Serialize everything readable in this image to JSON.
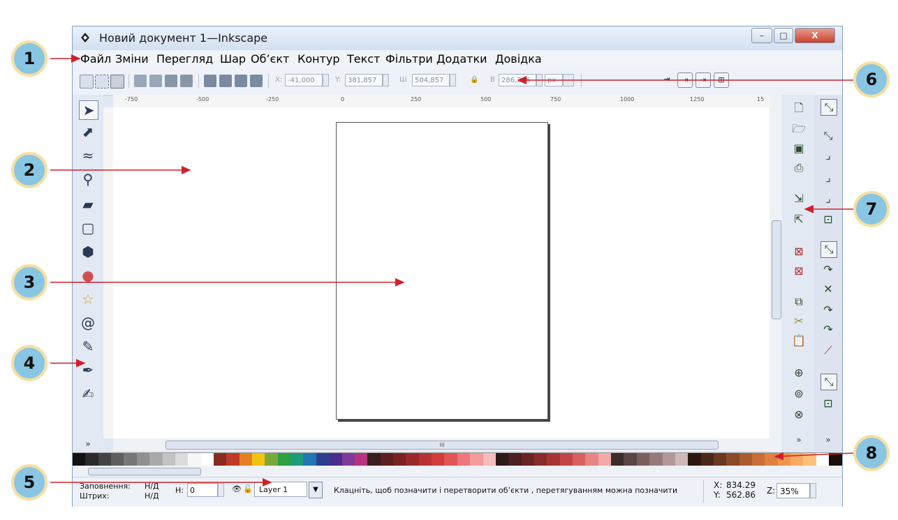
{
  "window": {
    "title": "Новий документ 1—Inkscape",
    "controls": {
      "minimize": "–",
      "maximize": "□",
      "close": "X"
    }
  },
  "menu": [
    "Файл",
    "Зміни",
    "Перегляд",
    "Шар",
    "Об’єкт",
    "Контур",
    "Текст",
    "Фільтри",
    "Додатки",
    "Довідка"
  ],
  "toolbar": {
    "x_label": "X:",
    "x_value": "-41,000",
    "y_label": "Y:",
    "y_value": "381,857",
    "w_label": "Ш",
    "w_value": "504,857",
    "h_label": "В",
    "h_value": "286,266",
    "units": "px"
  },
  "ruler": {
    "h_ticks": [
      "-750",
      "-500",
      "-250",
      "0",
      "250",
      "500",
      "750",
      "1000",
      "1250",
      "15"
    ]
  },
  "scroll": {
    "hscroll_grip": "III",
    "vscroll_grip": "III",
    "more": "»"
  },
  "status": {
    "fill_label": "Заповнення:",
    "fill_value": "Н/Д",
    "stroke_label": "Штрих:",
    "stroke_value": "Н/Д",
    "opacity_label": "Н:",
    "opacity_value": "0",
    "layer": "Layer 1",
    "message": "Клацніть, щоб позначити  і перетворити об’єкти , перетягуванням можна позначити",
    "x_label": "X:",
    "x_value": "834.29",
    "y_label": "Y:",
    "y_value": "562.86",
    "zoom_label": "Z:",
    "zoom_value": "35%"
  },
  "callouts": [
    "1",
    "2",
    "3",
    "4",
    "5",
    "6",
    "7",
    "8"
  ],
  "palette": [
    "#111111",
    "#2a2a2a",
    "#444444",
    "#5e5e5e",
    "#777777",
    "#909090",
    "#a9a9a9",
    "#c3c3c3",
    "#dcdcdc",
    "#f6f6f6",
    "#ffffff",
    "#8a2a20",
    "#c0392b",
    "#e67e22",
    "#f1c40f",
    "#7aa83a",
    "#2ea043",
    "#1b9e77",
    "#1f77b4",
    "#2c3e90",
    "#4b2c8c",
    "#7d3c98",
    "#b83280",
    "#3a1e1e",
    "#5c1f1f",
    "#7a2222",
    "#9a2a2a",
    "#b83232",
    "#d23c3c",
    "#e25555",
    "#ee7777",
    "#f49a9a",
    "#f8bcbc",
    "#2d1a1a",
    "#4a2020",
    "#6b2424",
    "#8a2b2b",
    "#a83535",
    "#c44545",
    "#d96060",
    "#e88383",
    "#f2a9a9",
    "#3b2b2b",
    "#5a4444",
    "#7a5e5e",
    "#967a7a",
    "#b29898",
    "#cdb9b9",
    "#2a1810",
    "#4a2818",
    "#6a3820",
    "#8a4a28",
    "#aa5c30",
    "#c86e38",
    "#e08040",
    "#f0944c",
    "#f8aa60",
    "#fcc07a",
    "#ffffff",
    "#1a0e0a"
  ],
  "colors": {
    "accent": "#88c6e4",
    "callout_border": "#f6dfa2",
    "arrow": "#d0202a"
  }
}
